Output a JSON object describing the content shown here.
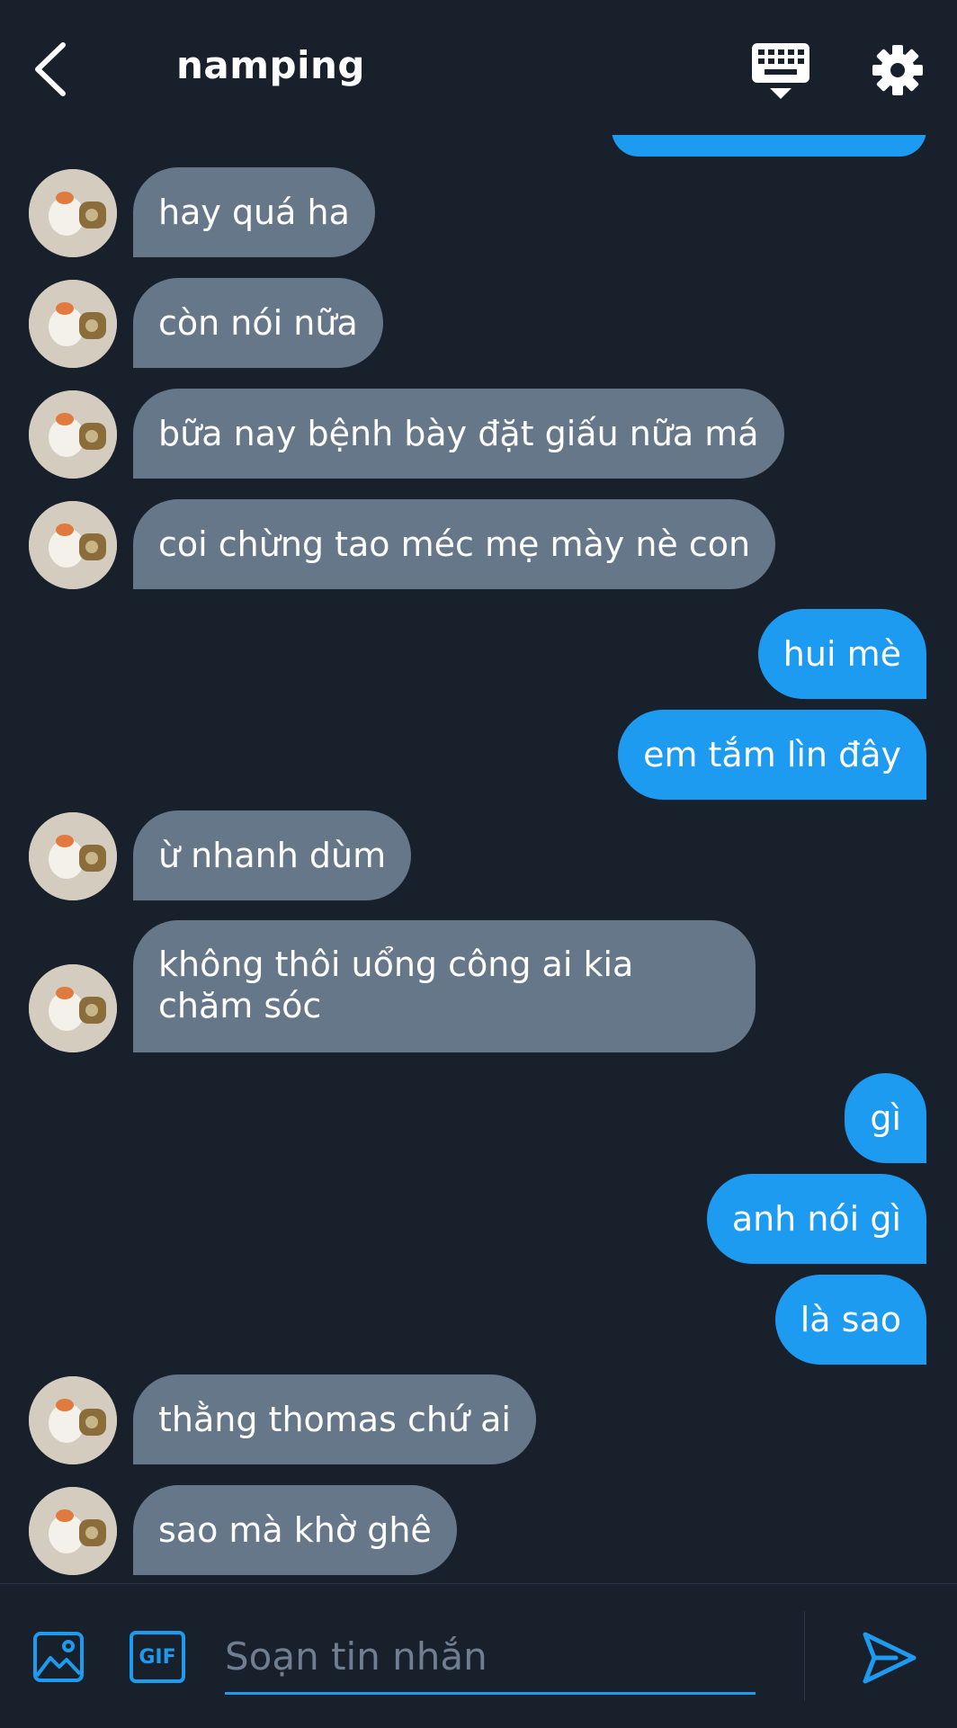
{
  "header": {
    "title": "namping",
    "back_icon": "chevron-left-icon",
    "keyboard_icon": "keyboard-icon",
    "settings_icon": "gear-icon"
  },
  "colors": {
    "background": "#18202b",
    "incoming_bubble": "#66778a",
    "outgoing_bubble": "#1d9bf0",
    "accent": "#1d9bf0"
  },
  "messages": [
    {
      "side": "in",
      "text": "hay quá ha"
    },
    {
      "side": "in",
      "text": "còn nói nữa"
    },
    {
      "side": "in",
      "text": "bữa nay bệnh bày đặt giấu nữa má"
    },
    {
      "side": "in",
      "text": "coi chừng tao méc mẹ mày nè con"
    },
    {
      "side": "out",
      "text": "hui mè"
    },
    {
      "side": "out",
      "text": "em tắm lìn đây"
    },
    {
      "side": "in",
      "text": "ừ nhanh dùm"
    },
    {
      "side": "in",
      "text": "không thôi uổng công ai kia chăm sóc"
    },
    {
      "side": "out",
      "text": "gì"
    },
    {
      "side": "out",
      "text": "anh nói gì"
    },
    {
      "side": "out",
      "text": "là sao"
    },
    {
      "side": "in",
      "text": "thằng thomas chứ ai"
    },
    {
      "side": "in",
      "text": "sao mà khờ ghê"
    }
  ],
  "composer": {
    "placeholder": "Soạn tin nhắn",
    "image_icon": "image-icon",
    "gif_icon": "gif-icon",
    "gif_label": "GIF",
    "send_icon": "send-icon"
  }
}
